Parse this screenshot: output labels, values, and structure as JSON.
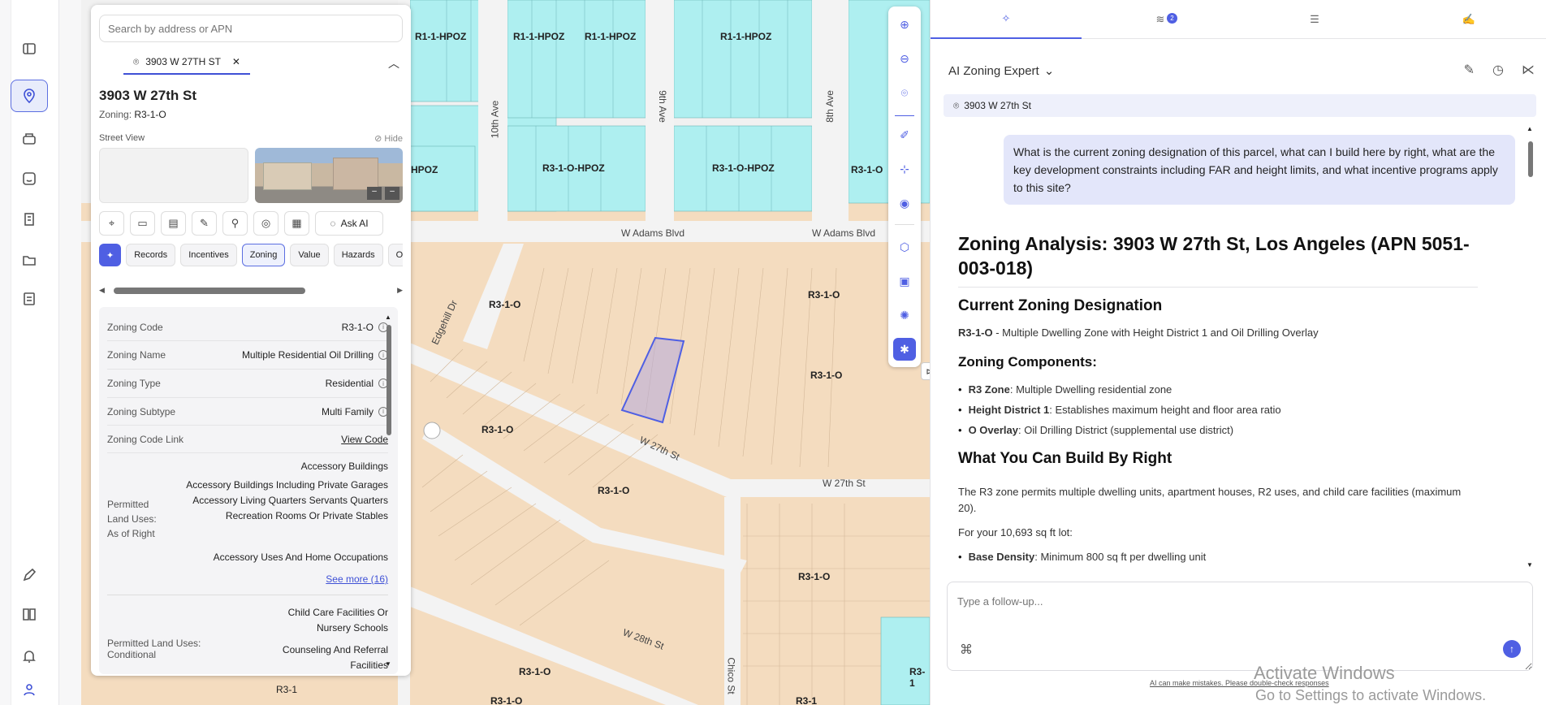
{
  "search": {
    "placeholder": "Search by address or APN"
  },
  "chip": {
    "label": "3903 W 27TH ST",
    "close": "✕"
  },
  "parcel": {
    "title": "3903 W 27th St",
    "zoning_label": "Zoning:",
    "zoning_value": "R3-1-O"
  },
  "street_view": {
    "label": "Street View",
    "hide": "Hide"
  },
  "ask_ai": "Ask AI",
  "tabs": [
    "Records",
    "Incentives",
    "Zoning",
    "Value",
    "Hazards",
    "Ov"
  ],
  "fields": [
    {
      "k": "Zoning Code",
      "v": "R3-1-O"
    },
    {
      "k": "Zoning Name",
      "v": "Multiple Residential Oil Drilling"
    },
    {
      "k": "Zoning Type",
      "v": "Residential"
    },
    {
      "k": "Zoning Subtype",
      "v": "Multi Family"
    },
    {
      "k": "Zoning Code Link",
      "v": "View Code"
    }
  ],
  "permitted": {
    "label": "Permitted Land Uses: As of Right",
    "items": [
      "Accessory Buildings",
      "Accessory Buildings Including Private Garages Accessory Living Quarters Servants Quarters Recreation Rooms Or Private Stables",
      "Accessory Uses And Home Occupations"
    ],
    "see_more": "See more (16)"
  },
  "conditional": {
    "label": "Permitted Land Uses: Conditional",
    "items": [
      "Child Care Facilities Or Nursery Schools",
      "Counseling And Referral Facilities"
    ]
  },
  "map_labels": {
    "zones": [
      "R1-1-HPOZ",
      "R1-1-HPOZ",
      "R1-1-HPOZ",
      "R1-1-HPOZ",
      "HPOZ",
      "R3-1-O-HPOZ",
      "R3-1-O-HPOZ",
      "R3-1-O",
      "R3-1-O",
      "R3-1-O",
      "R3-1-O",
      "R3-1-O",
      "R3-1-O",
      "R3-1-O",
      "R3-1-O",
      "R3-1-O",
      "R3-1",
      "R3-1",
      "R3-1"
    ],
    "streets": [
      "10th Ave",
      "9th Ave",
      "8th Ave",
      "W Adams Blvd",
      "W Adams Blvd",
      "Edgehill Dr",
      "W 27th St",
      "W 27th St",
      "W 28th St",
      "Chico St"
    ]
  },
  "right": {
    "expert": "AI Zoning Expert",
    "address": "3903 W 27th St",
    "badge": "2",
    "question": "What is the current zoning designation of this parcel, what can I build here by right, what are the key development constraints including FAR and height limits, and what incentive programs apply to this site?",
    "h1": "Zoning Analysis: 3903 W 27th St, Los Angeles (APN 5051-003-018)",
    "h2a": "Current Zoning Designation",
    "desig_code": "R3-1-O",
    "desig_text": " - Multiple Dwelling Zone with Height District 1 and Oil Drilling Overlay",
    "h2b": "Zoning Components:",
    "components": [
      {
        "b": "R3 Zone",
        "t": ": Multiple Dwelling residential zone"
      },
      {
        "b": "Height District 1",
        "t": ": Establishes maximum height and floor area ratio"
      },
      {
        "b": "O Overlay",
        "t": ": Oil Drilling District (supplemental use district)"
      }
    ],
    "h2c": "What You Can Build By Right",
    "p1": "The R3 zone permits multiple dwelling units, apartment houses, R2 uses, and child care facilities (maximum 20).",
    "p2": "For your 10,693 sq ft lot:",
    "bullet_b": "Base Density",
    "bullet_t": ": Minimum 800 sq ft per dwelling unit",
    "input_placeholder": "Type a follow-up...",
    "disclaimer": "AI can make mistakes. Please double-check responses"
  },
  "watermark": {
    "line1": "Activate Windows",
    "line2": "Go to Settings to activate Windows."
  },
  "colors": {
    "accent": "#4f5fe3",
    "hpoz": "#aeeff0",
    "residential": "#f4dcbf",
    "parcel": "#4f5fe3"
  }
}
